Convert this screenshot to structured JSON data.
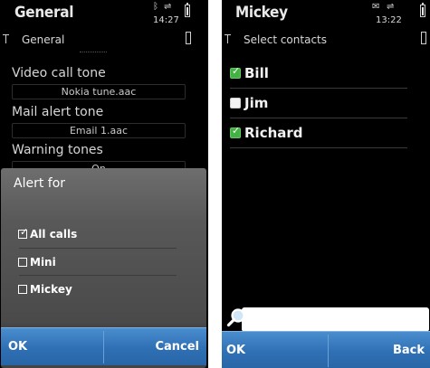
{
  "left": {
    "title": "General",
    "subtitle": "General",
    "time": "14:27",
    "status_icons": {
      "bluetooth": "bluetooth-icon",
      "usb": "usb-icon",
      "battery": "battery-icon",
      "signal": "signal-icon"
    },
    "settings": [
      {
        "label": "Video call tone",
        "value": "Nokia tune.aac"
      },
      {
        "label": "Mail alert tone",
        "value": "Email 1.aac"
      },
      {
        "label": "Warning tones",
        "value": "On"
      }
    ],
    "dialog": {
      "title": "Alert for",
      "options": [
        {
          "label": "All calls",
          "checked": true
        },
        {
          "label": "Mini",
          "checked": false
        },
        {
          "label": "Mickey",
          "checked": false
        }
      ],
      "ok_label": "OK",
      "cancel_label": "Cancel"
    }
  },
  "right": {
    "title": "Mickey",
    "subtitle": "Select contacts",
    "time": "13:22",
    "status_icons": {
      "mail": "mail-icon",
      "usb": "usb-icon",
      "battery": "battery-icon",
      "signal": "signal-icon"
    },
    "contacts": [
      {
        "name": "Bill",
        "checked": true
      },
      {
        "name": "Jim",
        "checked": false
      },
      {
        "name": "Richard",
        "checked": true
      }
    ],
    "search": {
      "value": "",
      "icon": "search-icon"
    },
    "ok_label": "OK",
    "back_label": "Back"
  },
  "colors": {
    "softkey_bar": "#2f6fb4",
    "check_green": "#43b143",
    "background": "#000000"
  }
}
